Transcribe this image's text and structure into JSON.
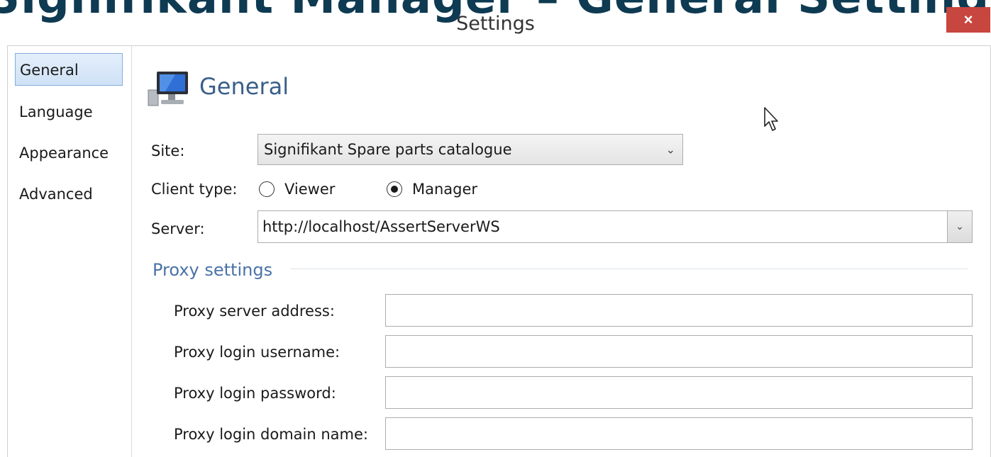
{
  "slide": {
    "heading": "Signifikant Manager – General Settings"
  },
  "window": {
    "title": "Settings",
    "close_label": "×"
  },
  "sidebar": {
    "items": [
      {
        "label": "General",
        "active": true
      },
      {
        "label": "Language",
        "active": false
      },
      {
        "label": "Appearance",
        "active": false
      },
      {
        "label": "Advanced",
        "active": false
      }
    ]
  },
  "section": {
    "title": "General",
    "icon": "computer-icon"
  },
  "form": {
    "site_label": "Site:",
    "site_value": "Signifikant Spare parts catalogue",
    "client_type_label": "Client type:",
    "client_type_options": [
      {
        "label": "Viewer",
        "checked": false
      },
      {
        "label": "Manager",
        "checked": true
      }
    ],
    "server_label": "Server:",
    "server_value": "http://localhost/AssertServerWS"
  },
  "proxy": {
    "group_title": "Proxy settings",
    "fields": [
      {
        "label": "Proxy server address:",
        "value": ""
      },
      {
        "label": "Proxy login username:",
        "value": ""
      },
      {
        "label": "Proxy login password:",
        "value": ""
      },
      {
        "label": "Proxy login domain name:",
        "value": ""
      }
    ]
  },
  "colors": {
    "accent": "#3a5f8a",
    "close_button": "#c7463f",
    "selected_nav": "#cfe1f6"
  }
}
